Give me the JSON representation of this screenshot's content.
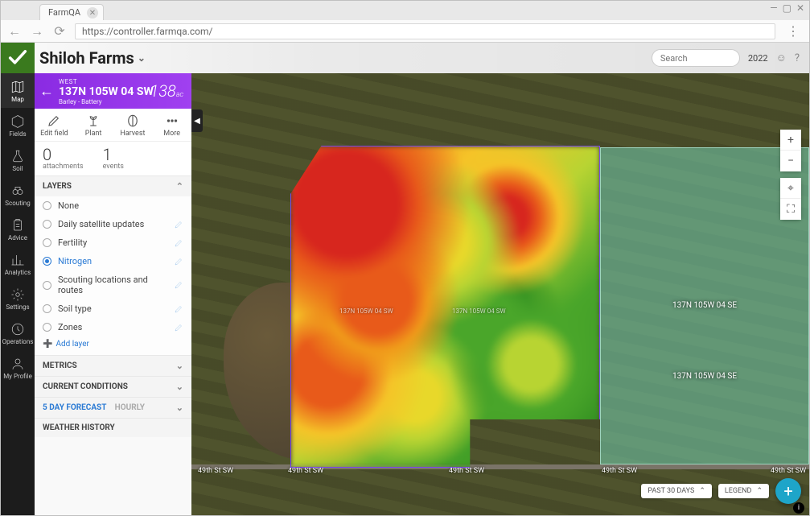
{
  "browser": {
    "tab_title": "FarmQA",
    "url": "https://controller.farmqa.com/"
  },
  "topbar": {
    "farm": "Shiloh Farms",
    "search_placeholder": "Search",
    "year": "2022"
  },
  "app_nav": [
    {
      "id": "map",
      "label": "Map",
      "active": true
    },
    {
      "id": "fields",
      "label": "Fields"
    },
    {
      "id": "soil",
      "label": "Soil"
    },
    {
      "id": "scouting",
      "label": "Scouting"
    },
    {
      "id": "advice",
      "label": "Advice"
    },
    {
      "id": "analytics",
      "label": "Analytics"
    },
    {
      "id": "settings",
      "label": "Settings"
    },
    {
      "id": "operations",
      "label": "Operations"
    },
    {
      "id": "profile",
      "label": "My Profile"
    }
  ],
  "field": {
    "area": "WEST",
    "name": "137N 105W 04 SW",
    "crop": "Barley - Battery",
    "acres": "138",
    "acres_unit": "ac"
  },
  "tools": {
    "edit": "Edit field",
    "plant": "Plant",
    "harvest": "Harvest",
    "more": "More"
  },
  "counts": {
    "attachments_n": "0",
    "attachments_l": "attachments",
    "events_n": "1",
    "events_l": "events"
  },
  "layers_title": "LAYERS",
  "layers": [
    {
      "label": "None",
      "editable": false
    },
    {
      "label": "Daily satellite updates",
      "editable": true
    },
    {
      "label": "Fertility",
      "editable": true
    },
    {
      "label": "Nitrogen",
      "editable": true,
      "selected": true
    },
    {
      "label": "Scouting locations and routes",
      "editable": true
    },
    {
      "label": "Soil type",
      "editable": true
    },
    {
      "label": "Zones",
      "editable": true
    }
  ],
  "add_layer": "Add layer",
  "sections": {
    "metrics": "METRICS",
    "current": "CURRENT CONDITIONS",
    "forecast_5day": "5 DAY FORECAST",
    "forecast_hourly": "HOURLY",
    "history": "WEATHER HISTORY"
  },
  "map_labels": {
    "sw1": "137N 105W 04 SW",
    "sw2": "137N 105W 04 SW",
    "se1": "137N 105W 04 SE",
    "se2": "137N 105W 04 SE",
    "road": "49th St SW"
  },
  "bottom": {
    "past30": "PAST 30 DAYS",
    "legend": "LEGEND"
  }
}
